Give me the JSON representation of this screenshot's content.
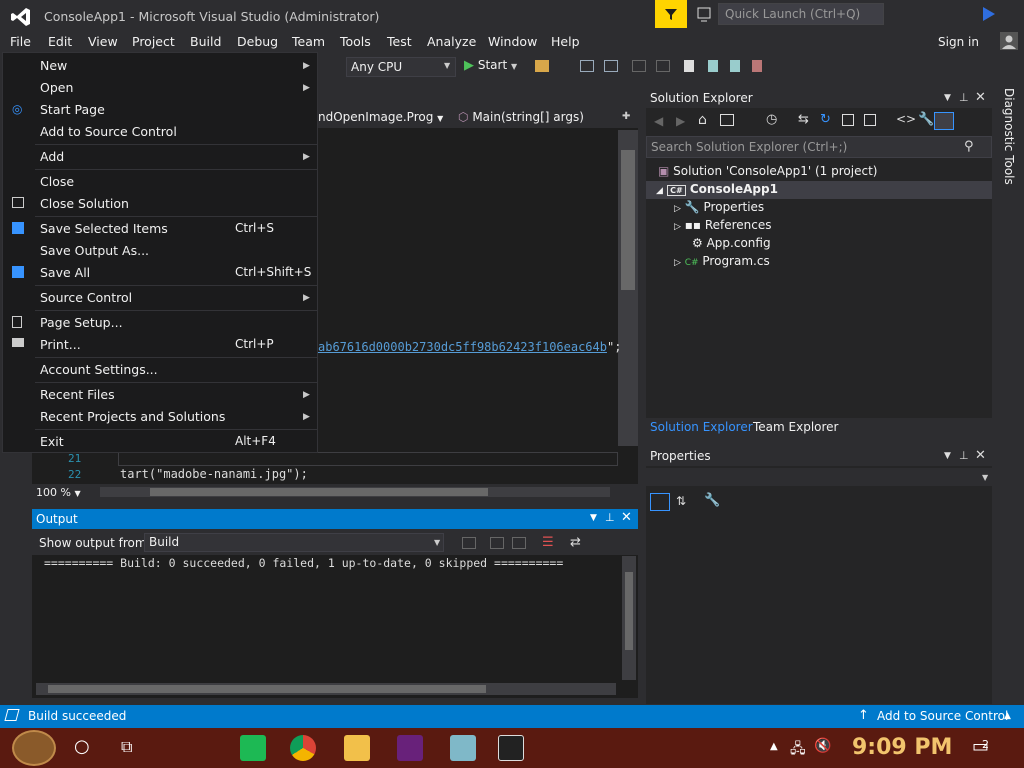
{
  "window": {
    "title": "ConsoleApp1 - Microsoft Visual Studio  (Administrator)",
    "quick_launch_placeholder": "Quick Launch (Ctrl+Q)",
    "sign_in": "Sign in"
  },
  "menubar": {
    "items": [
      "File",
      "Edit",
      "View",
      "Project",
      "Build",
      "Debug",
      "Team",
      "Tools",
      "Test",
      "Analyze",
      "Window",
      "Help"
    ]
  },
  "toolbar": {
    "platform": "Any CPU",
    "start_label": "Start"
  },
  "file_menu": {
    "items": [
      {
        "label": "New",
        "shortcut": "",
        "submenu": true
      },
      {
        "label": "Open",
        "shortcut": "",
        "submenu": true
      },
      {
        "label": "Start Page",
        "shortcut": "",
        "submenu": false
      },
      {
        "label": "Add to Source Control",
        "shortcut": "",
        "submenu": false
      },
      {
        "label": "Add",
        "shortcut": "",
        "submenu": true
      },
      {
        "label": "Close",
        "shortcut": "",
        "submenu": false
      },
      {
        "label": "Close Solution",
        "shortcut": "",
        "submenu": false
      },
      {
        "label": "Save Selected Items",
        "shortcut": "Ctrl+S",
        "submenu": false
      },
      {
        "label": "Save Output As...",
        "shortcut": "",
        "submenu": false
      },
      {
        "label": "Save All",
        "shortcut": "Ctrl+Shift+S",
        "submenu": false
      },
      {
        "label": "Source Control",
        "shortcut": "",
        "submenu": true
      },
      {
        "label": "Page Setup...",
        "shortcut": "",
        "submenu": false
      },
      {
        "label": "Print...",
        "shortcut": "Ctrl+P",
        "submenu": false
      },
      {
        "label": "Account Settings...",
        "shortcut": "",
        "submenu": false
      },
      {
        "label": "Recent Files",
        "shortcut": "",
        "submenu": true
      },
      {
        "label": "Recent Projects and Solutions",
        "shortcut": "",
        "submenu": true
      },
      {
        "label": "Exit",
        "shortcut": "Alt+F4",
        "submenu": false
      }
    ]
  },
  "editor": {
    "nav_file": "ndOpenImage.Prog",
    "nav_member": "Main(string[] args)",
    "hash_text": "ab67616d0000b2730dc5ff98b62423f106eac64b",
    "hash_suffix": "\";",
    "line_21": "21",
    "line_22": "22",
    "code_22": "tart(\"madobe-nanami.jpg\");",
    "zoom": "100 %"
  },
  "output": {
    "title": "Output",
    "show_from_label": "Show output from:",
    "source": "Build",
    "line": "========== Build: 0 succeeded, 0 failed, 1 up-to-date, 0 skipped =========="
  },
  "solution_explorer": {
    "title": "Solution Explorer",
    "search_placeholder": "Search Solution Explorer (Ctrl+;)",
    "solution": "Solution 'ConsoleApp1' (1 project)",
    "project": "ConsoleApp1",
    "children": [
      "Properties",
      "References",
      "App.config",
      "Program.cs"
    ],
    "tab_active": "Solution Explorer",
    "tab_other": "Team Explorer"
  },
  "properties": {
    "title": "Properties"
  },
  "diagnostic_tools": "Diagnostic Tools",
  "statusbar": {
    "left": "Build succeeded",
    "right": "Add to Source Control"
  },
  "taskbar": {
    "clock": "9:09 PM",
    "notification_count": "2"
  },
  "colors": {
    "accent": "#007acc",
    "menu_bg": "#1b1b1c",
    "editor_bg": "#1e1e1e"
  }
}
